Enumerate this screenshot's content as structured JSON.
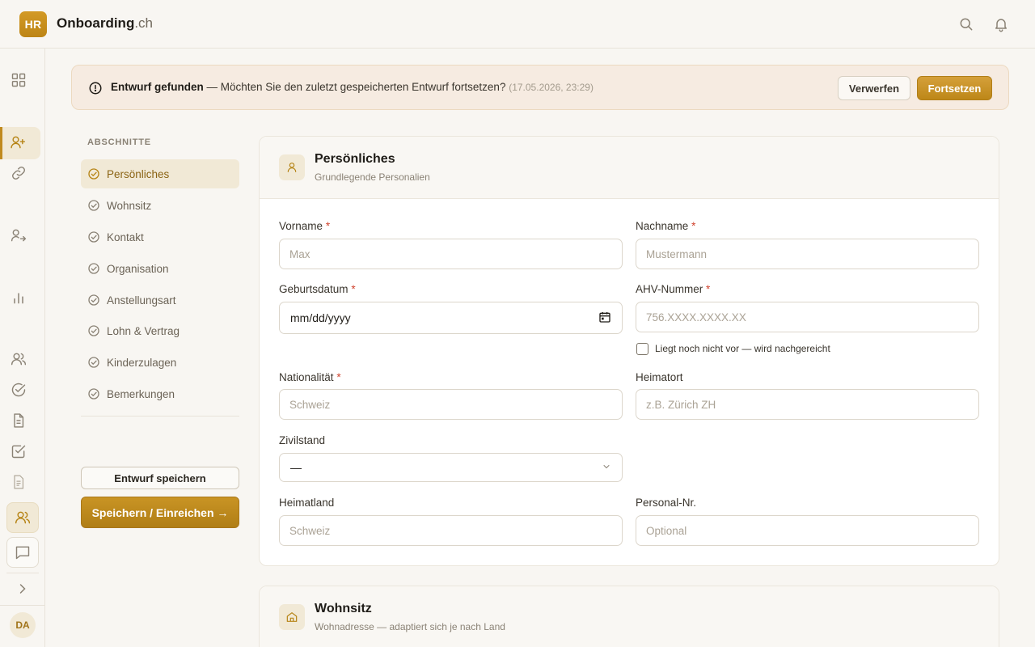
{
  "app": {
    "logo_text": "HR",
    "brand_name": "Onboarding",
    "brand_tld": ".ch",
    "user_initials": "DA",
    "accent": "#c08a1e"
  },
  "banner": {
    "title": "Entwurf gefunden",
    "message": " — Möchten Sie den zuletzt gespeicherten Entwurf fortsetzen? ",
    "timestamp": "(17.05.2026, 23:29)",
    "discard_label": "Verwerfen",
    "continue_label": "Fortsetzen"
  },
  "sections": {
    "heading": "ABSCHNITTE",
    "items": [
      {
        "label": "Persönliches"
      },
      {
        "label": "Wohnsitz"
      },
      {
        "label": "Kontakt"
      },
      {
        "label": "Organisation"
      },
      {
        "label": "Anstellungsart"
      },
      {
        "label": "Lohn & Vertrag"
      },
      {
        "label": "Kinderzulagen"
      },
      {
        "label": "Bemerkungen"
      }
    ],
    "save_draft_label": "Entwurf speichern",
    "submit_label": "Speichern / Einreichen →"
  },
  "personal": {
    "title": "Persönliches",
    "subtitle": "Grundlegende Personalien",
    "first_name": {
      "label": "Vorname",
      "required": "*",
      "placeholder": "Max"
    },
    "last_name": {
      "label": "Nachname",
      "required": "*",
      "placeholder": "Mustermann"
    },
    "birthdate": {
      "label": "Geburtsdatum",
      "required": "*",
      "value": "mm/dd/yyyy"
    },
    "ahv": {
      "label": "AHV-Nummer",
      "required": "*",
      "placeholder": "756.XXXX.XXXX.XX",
      "pending_label": "Liegt noch nicht vor — wird nachgereicht"
    },
    "nationality": {
      "label": "Nationalität",
      "required": "*",
      "placeholder": "Schweiz"
    },
    "hometown": {
      "label": "Heimatort",
      "placeholder": "z.B. Zürich ZH"
    },
    "civil_status": {
      "label": "Zivilstand",
      "value": "—"
    },
    "home_country": {
      "label": "Heimatland",
      "placeholder": "Schweiz"
    },
    "personnel_no": {
      "label": "Personal-Nr.",
      "placeholder": "Optional"
    }
  },
  "residence": {
    "title": "Wohnsitz",
    "subtitle": "Wohnadresse — adaptiert sich je nach Land"
  }
}
